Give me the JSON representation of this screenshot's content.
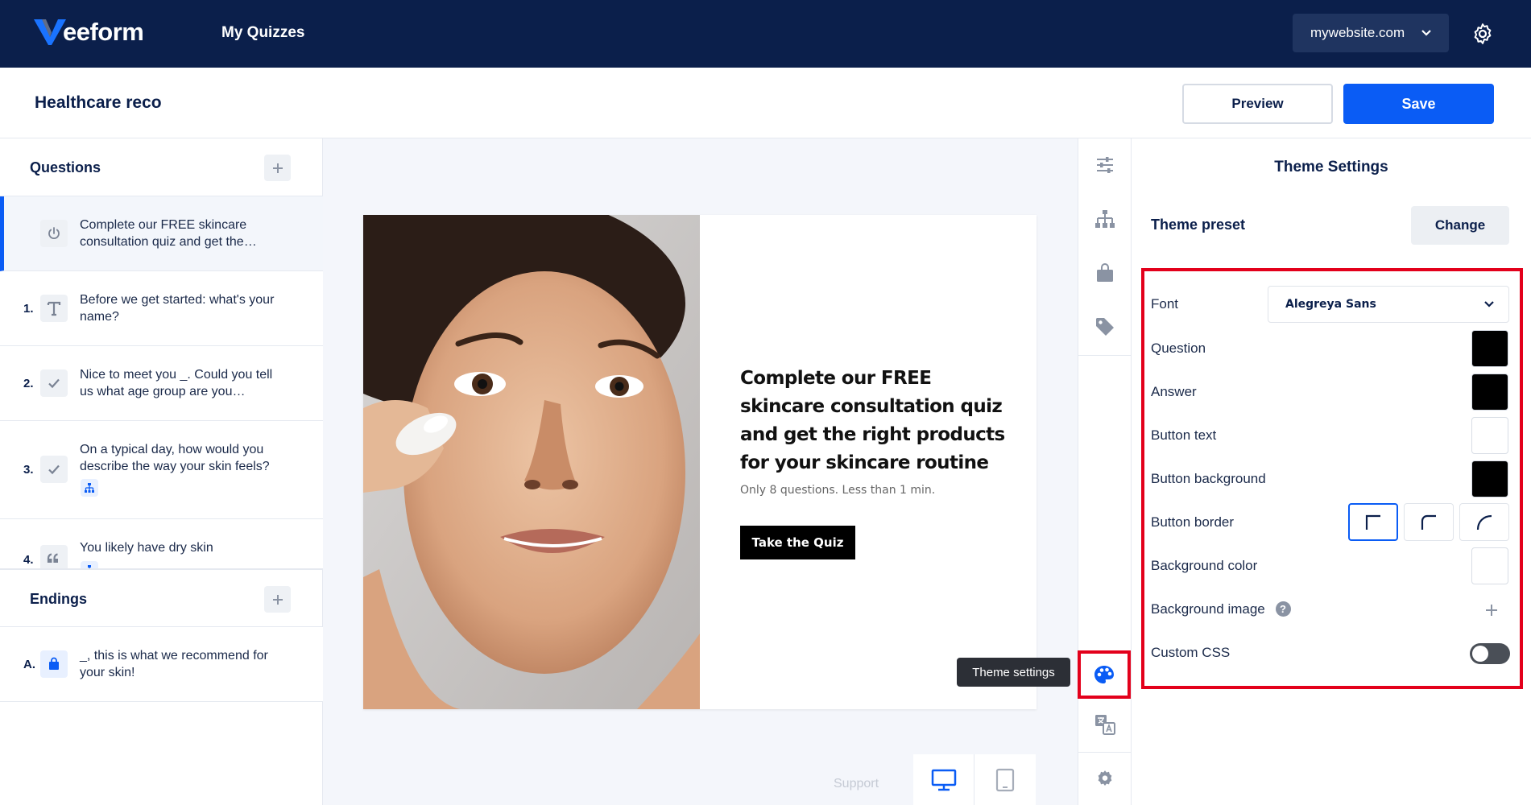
{
  "topnav": {
    "logo_text": "eeform",
    "nav_link": "My Quizzes",
    "site_select": "mywebsite.com"
  },
  "header": {
    "quiz_title": "Healthcare reco",
    "preview_label": "Preview",
    "save_label": "Save"
  },
  "sidebar": {
    "questions_label": "Questions",
    "endings_label": "Endings",
    "questions": [
      {
        "num": "",
        "text": "Complete our FREE skincare consultation quiz and get the…",
        "icon": "power-icon"
      },
      {
        "num": "1.",
        "text": "Before we get started: what's your name?",
        "icon": "text-icon"
      },
      {
        "num": "2.",
        "text": "Nice to meet you _. Could you tell us what age group are you…",
        "icon": "check-icon"
      },
      {
        "num": "3.",
        "text": "On a typical day, how would you describe the way your skin feels?",
        "icon": "check-icon"
      },
      {
        "num": "4.",
        "text": "You likely have dry skin",
        "icon": "quote-icon"
      }
    ],
    "endings": [
      {
        "num": "A.",
        "text": "_, this is what we recommend for your skin!",
        "icon": "bag-icon"
      }
    ]
  },
  "canvas": {
    "card_title": "Complete our FREE skincare consultation quiz and get the right products for your skincare routine",
    "card_subtitle": "Only 8 questions. Less than 1 min.",
    "card_button": "Take the Quiz",
    "tooltip": "Theme settings",
    "support": "Support"
  },
  "panel": {
    "title": "Theme Settings",
    "preset_label": "Theme preset",
    "change_label": "Change",
    "font_label": "Font",
    "font_value": "Alegreya Sans",
    "question_label": "Question",
    "answer_label": "Answer",
    "button_text_label": "Button text",
    "button_bg_label": "Button background",
    "button_border_label": "Button border",
    "bg_color_label": "Background color",
    "bg_image_label": "Background image",
    "custom_css_label": "Custom CSS",
    "help_glyph": "?"
  },
  "colors": {
    "question": "#000000",
    "answer": "#000000",
    "button_text": "#ffffff",
    "button_background": "#000000",
    "background": "#ffffff",
    "accent": "#0a5cf5",
    "nav": "#0b1f4b",
    "highlight": "#e3001b"
  }
}
